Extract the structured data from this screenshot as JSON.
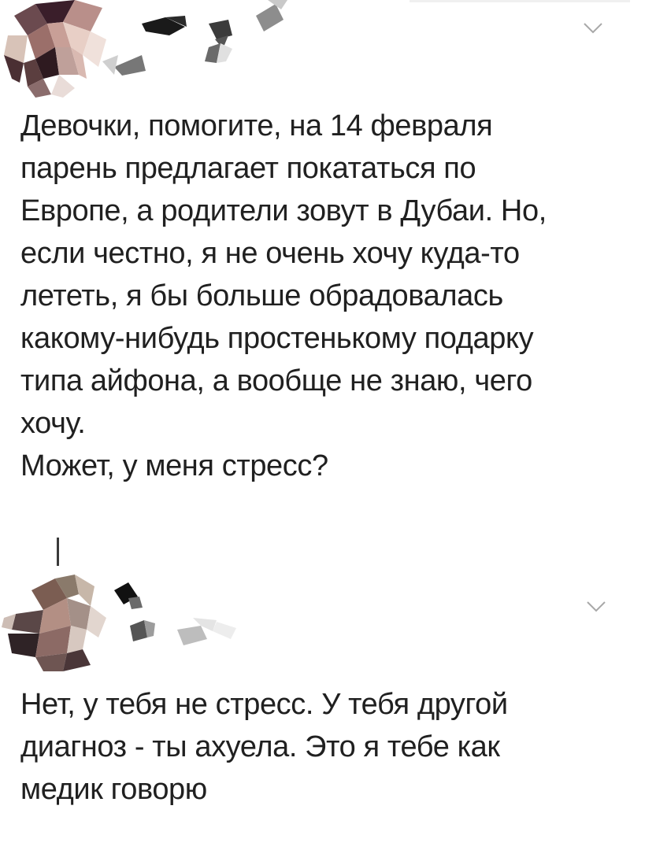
{
  "posts": [
    {
      "avatar_icon": "pixelated-avatar",
      "username_icon": "pixelated-username",
      "menu_icon": "chevron-down-icon",
      "lines": [
        "Девочки, помогите, на 14 февраля",
        "парень предлагает покататься по",
        "Европе, а родители зовут в Дубаи. Но,",
        "если честно, я не очень хочу куда-то",
        "лететь, я бы больше обрадовалась",
        "какому-нибудь простенькому подарку",
        "типа айфона, а вообще не знаю, чего",
        "хочу.",
        "Может, у меня стресс?"
      ]
    },
    {
      "avatar_icon": "pixelated-avatar",
      "username_icon": "pixelated-username",
      "menu_icon": "chevron-down-icon",
      "lines": [
        "Нет, у тебя не стресс. У тебя другой",
        "диагноз - ты ахуела. Это я тебе как",
        "медик говорю"
      ]
    }
  ]
}
